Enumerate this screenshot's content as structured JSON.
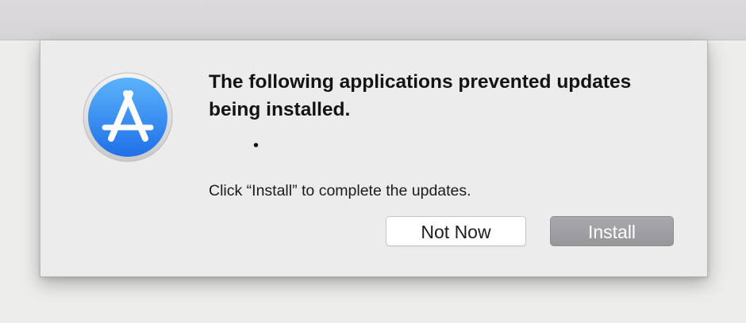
{
  "dialog": {
    "title": "The following applications prevented updates being installed.",
    "bullet_item": "•",
    "message": "Click “Install” to complete the updates.",
    "buttons": {
      "not_now_label": "Not Now",
      "install_label": "Install"
    },
    "icon": "app-store-icon"
  },
  "colors": {
    "icon_blue": "#2f7ff0",
    "install_button": "#a0a0a4",
    "dialog_background": "#ececec"
  }
}
